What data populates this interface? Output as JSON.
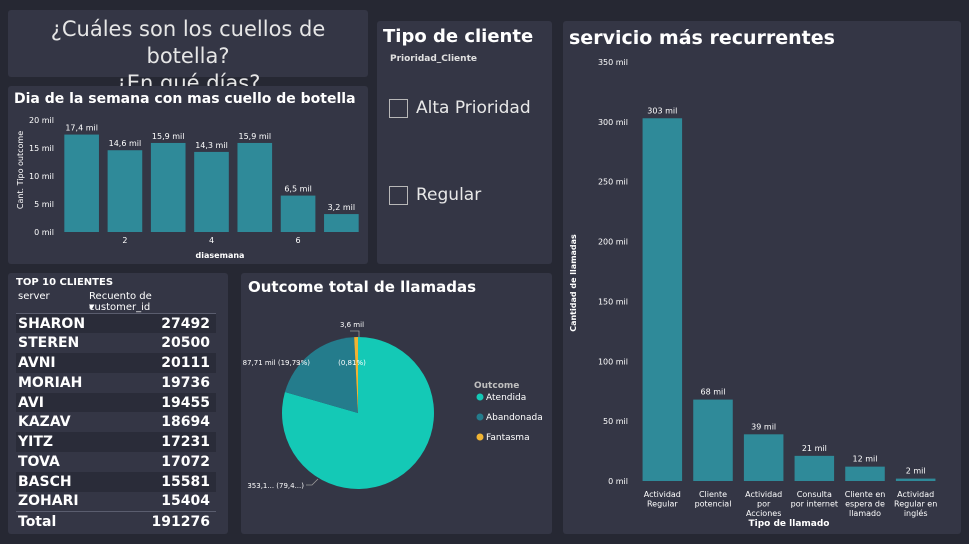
{
  "header": {
    "line1": "¿Cuáles son los cuellos de botella?",
    "line2": "¿En qué días?"
  },
  "colors": {
    "bar": "#2f8a99",
    "atendida": "#14c9b6",
    "abandonada": "#247c8c",
    "fantasma": "#f0b433"
  },
  "slicer": {
    "title": "Tipo de cliente",
    "field": "Prioridad_Cliente",
    "options": [
      {
        "label": "Alta Prioridad",
        "checked": false
      },
      {
        "label": "Regular",
        "checked": false
      }
    ]
  },
  "top_clients": {
    "title": "TOP 10 CLIENTES",
    "col_server": "server",
    "col_count": "Recuento de customer_id",
    "sort_icon": "sort-descending-icon",
    "rows": [
      {
        "server": "SHARON",
        "count": "27492"
      },
      {
        "server": "STEREN",
        "count": "20500"
      },
      {
        "server": "AVNI",
        "count": "20111"
      },
      {
        "server": "MORIAH",
        "count": "19736"
      },
      {
        "server": "AVI",
        "count": "19455"
      },
      {
        "server": "KAZAV",
        "count": "18694"
      },
      {
        "server": "YITZ",
        "count": "17231"
      },
      {
        "server": "TOVA",
        "count": "17072"
      },
      {
        "server": "BASCH",
        "count": "15581"
      },
      {
        "server": "ZOHARI",
        "count": "15404"
      }
    ],
    "total_label": "Total",
    "total_value": "191276"
  },
  "chart_data": [
    {
      "id": "week",
      "type": "bar",
      "title": "Dia de la semana con mas cuello de botella",
      "xlabel": "diasemana",
      "ylabel": "Cant. Tipo outcome",
      "ylim": [
        0,
        20000
      ],
      "yticks": [
        0,
        5000,
        10000,
        15000,
        20000
      ],
      "ytick_labels": [
        "0 mil",
        "5 mil",
        "10 mil",
        "15 mil",
        "20 mil"
      ],
      "x": [
        1,
        2,
        3,
        4,
        5,
        6,
        7
      ],
      "xtick_labels": [
        "",
        "2",
        "",
        "4",
        "",
        "6",
        ""
      ],
      "values": [
        17400,
        14600,
        15900,
        14300,
        15900,
        6500,
        3200
      ],
      "data_labels": [
        "17,4 mil",
        "14,6 mil",
        "15,9 mil",
        "14,3 mil",
        "15,9 mil",
        "6,5 mil",
        "3,2 mil"
      ],
      "grid": false
    },
    {
      "id": "serv",
      "type": "bar",
      "title": "servicio más recurrentes",
      "xlabel": "Tipo de llamado",
      "ylabel": "Cantidad de llamadas",
      "ylim": [
        0,
        350000
      ],
      "yticks": [
        0,
        50000,
        100000,
        150000,
        200000,
        250000,
        300000,
        350000
      ],
      "ytick_labels": [
        "0 mil",
        "50 mil",
        "100 mil",
        "150 mil",
        "200 mil",
        "250 mil",
        "300 mil",
        "350 mil"
      ],
      "categories": [
        [
          "Actividad",
          "Regular"
        ],
        [
          "Cliente",
          "potencial"
        ],
        [
          "Actividad",
          "por",
          "Acciones"
        ],
        [
          "Consulta",
          "por internet"
        ],
        [
          "Cliente en",
          "espera de",
          "llamado"
        ],
        [
          "Actividad",
          "Regular en",
          "inglés"
        ]
      ],
      "values": [
        303000,
        68000,
        39000,
        21000,
        12000,
        2000
      ],
      "data_labels": [
        "303 mil",
        "68 mil",
        "39 mil",
        "21 mil",
        "12 mil",
        "2 mil"
      ],
      "grid": false
    },
    {
      "id": "pie",
      "type": "pie",
      "title": "Outcome total de llamadas",
      "legend_title": "Outcome",
      "legend_position": "right",
      "categories": [
        "Atendida",
        "Abandonada",
        "Fantasma"
      ],
      "values": [
        353100,
        87710,
        3600
      ],
      "data_labels": [
        "353,1... (79,4...)",
        "87,71 mil (19,73%)",
        "3,6 mil",
        "(0,81%)"
      ]
    }
  ]
}
